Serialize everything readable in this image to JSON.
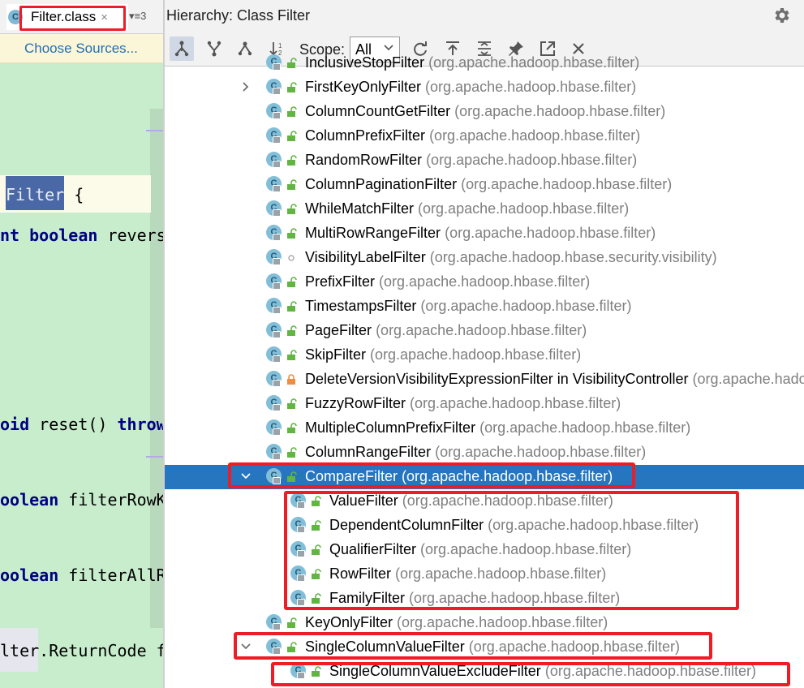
{
  "editor": {
    "tab_label": "Filter.class",
    "tab_close": "×",
    "tab_more": "▾≡3",
    "choose_sources": "Choose Sources...",
    "code_lines": [
      {
        "pre": " ",
        "sel": "Filter",
        "post": " {"
      },
      {
        "kw": "nt boolean",
        "text": " revers"
      },
      {
        "kw": "oid",
        "text": " reset() ",
        "kw2": "throw"
      },
      {
        "kw": "oolean",
        "text": " filterRowK"
      },
      {
        "kw": "oolean",
        "text": " filterAllR"
      },
      {
        "text": "lter.ReturnCode f"
      }
    ]
  },
  "hierarchy": {
    "title": "Hierarchy:  Class Filter",
    "scope_label": "Scope:",
    "scope_value": "All",
    "toolbar_icons": [
      "subtypes-hierarchy-icon",
      "supertypes-hierarchy-icon",
      "class-hierarchy-icon",
      "sort-alphabetically-icon",
      "refresh-icon",
      "export-icon",
      "expand-all-icon",
      "pin-icon",
      "open-in-window-icon",
      "close-icon"
    ],
    "rows": [
      {
        "name": "InclusiveStopFilter",
        "pkg": "(org.apache.hadoop.hbase.filter)",
        "arrow": "none",
        "indent": 0,
        "vis": "public"
      },
      {
        "name": "FirstKeyOnlyFilter",
        "pkg": "(org.apache.hadoop.hbase.filter)",
        "arrow": "right",
        "indent": 0,
        "vis": "public"
      },
      {
        "name": "ColumnCountGetFilter",
        "pkg": "(org.apache.hadoop.hbase.filter)",
        "arrow": "none",
        "indent": 0,
        "vis": "public"
      },
      {
        "name": "ColumnPrefixFilter",
        "pkg": "(org.apache.hadoop.hbase.filter)",
        "arrow": "none",
        "indent": 0,
        "vis": "public"
      },
      {
        "name": "RandomRowFilter",
        "pkg": "(org.apache.hadoop.hbase.filter)",
        "arrow": "none",
        "indent": 0,
        "vis": "public"
      },
      {
        "name": "ColumnPaginationFilter",
        "pkg": "(org.apache.hadoop.hbase.filter)",
        "arrow": "none",
        "indent": 0,
        "vis": "public"
      },
      {
        "name": "WhileMatchFilter",
        "pkg": "(org.apache.hadoop.hbase.filter)",
        "arrow": "none",
        "indent": 0,
        "vis": "public"
      },
      {
        "name": "MultiRowRangeFilter",
        "pkg": "(org.apache.hadoop.hbase.filter)",
        "arrow": "none",
        "indent": 0,
        "vis": "public"
      },
      {
        "name": "VisibilityLabelFilter",
        "pkg": "(org.apache.hadoop.hbase.security.visibility)",
        "arrow": "none",
        "indent": 0,
        "vis": "package"
      },
      {
        "name": "PrefixFilter",
        "pkg": "(org.apache.hadoop.hbase.filter)",
        "arrow": "none",
        "indent": 0,
        "vis": "public"
      },
      {
        "name": "TimestampsFilter",
        "pkg": "(org.apache.hadoop.hbase.filter)",
        "arrow": "none",
        "indent": 0,
        "vis": "public"
      },
      {
        "name": "PageFilter",
        "pkg": "(org.apache.hadoop.hbase.filter)",
        "arrow": "none",
        "indent": 0,
        "vis": "public"
      },
      {
        "name": "SkipFilter",
        "pkg": "(org.apache.hadoop.hbase.filter)",
        "arrow": "none",
        "indent": 0,
        "vis": "public"
      },
      {
        "name": "DeleteVersionVisibilityExpressionFilter in VisibilityController",
        "pkg": "(org.apache.hadoop.hbase.security.visibility)",
        "arrow": "none",
        "indent": 0,
        "vis": "private"
      },
      {
        "name": "FuzzyRowFilter",
        "pkg": "(org.apache.hadoop.hbase.filter)",
        "arrow": "none",
        "indent": 0,
        "vis": "public"
      },
      {
        "name": "MultipleColumnPrefixFilter",
        "pkg": "(org.apache.hadoop.hbase.filter)",
        "arrow": "none",
        "indent": 0,
        "vis": "public"
      },
      {
        "name": "ColumnRangeFilter",
        "pkg": "(org.apache.hadoop.hbase.filter)",
        "arrow": "none",
        "indent": 0,
        "vis": "public"
      },
      {
        "name": "CompareFilter",
        "pkg": "(org.apache.hadoop.hbase.filter)",
        "arrow": "down",
        "indent": 0,
        "vis": "public",
        "selected": true
      },
      {
        "name": "ValueFilter",
        "pkg": "(org.apache.hadoop.hbase.filter)",
        "arrow": "none",
        "indent": 1,
        "vis": "public"
      },
      {
        "name": "DependentColumnFilter",
        "pkg": "(org.apache.hadoop.hbase.filter)",
        "arrow": "none",
        "indent": 1,
        "vis": "public"
      },
      {
        "name": "QualifierFilter",
        "pkg": "(org.apache.hadoop.hbase.filter)",
        "arrow": "none",
        "indent": 1,
        "vis": "public"
      },
      {
        "name": "RowFilter",
        "pkg": "(org.apache.hadoop.hbase.filter)",
        "arrow": "none",
        "indent": 1,
        "vis": "public"
      },
      {
        "name": "FamilyFilter",
        "pkg": "(org.apache.hadoop.hbase.filter)",
        "arrow": "none",
        "indent": 1,
        "vis": "public"
      },
      {
        "name": "KeyOnlyFilter",
        "pkg": "(org.apache.hadoop.hbase.filter)",
        "arrow": "none",
        "indent": 0,
        "vis": "public"
      },
      {
        "name": "SingleColumnValueFilter",
        "pkg": "(org.apache.hadoop.hbase.filter)",
        "arrow": "down",
        "indent": 0,
        "vis": "public"
      },
      {
        "name": "SingleColumnValueExcludeFilter",
        "pkg": "(org.apache.hadoop.hbase.filter)",
        "arrow": "none",
        "indent": 1,
        "vis": "public"
      }
    ]
  },
  "colors": {
    "selection": "#2675bf",
    "annotation_red": "#ee1c24",
    "editor_bg": "#c7edcc",
    "package_gray": "#7f7f7f",
    "lock_green": "#62b543"
  }
}
